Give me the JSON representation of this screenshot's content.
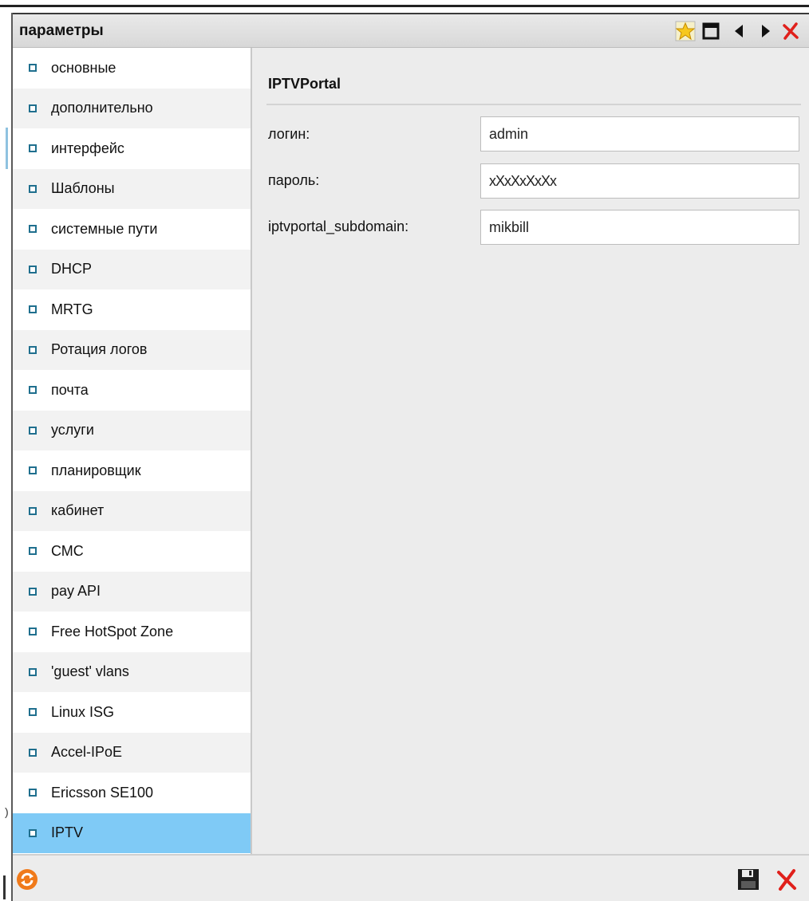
{
  "window": {
    "title": "параметры",
    "titlebar_icons": [
      "star-icon",
      "maximize-icon",
      "arrow-left-icon",
      "arrow-right-icon",
      "close-icon"
    ]
  },
  "sidebar": {
    "items": [
      {
        "label": "основные"
      },
      {
        "label": "дополнительно"
      },
      {
        "label": "интерфейс"
      },
      {
        "label": "Шаблоны"
      },
      {
        "label": "системные пути"
      },
      {
        "label": "DHCP"
      },
      {
        "label": "MRTG"
      },
      {
        "label": "Ротация логов"
      },
      {
        "label": "почта"
      },
      {
        "label": "услуги"
      },
      {
        "label": "планировщик"
      },
      {
        "label": "кабинет"
      },
      {
        "label": "СМС"
      },
      {
        "label": "pay API"
      },
      {
        "label": "Free HotSpot Zone"
      },
      {
        "label": "'guest' vlans"
      },
      {
        "label": "Linux ISG"
      },
      {
        "label": "Accel-IPoE"
      },
      {
        "label": "Ericsson SE100"
      },
      {
        "label": "IPTV",
        "active": true
      }
    ]
  },
  "main": {
    "section_title": "IPTVPortal",
    "fields": [
      {
        "label": "логин:",
        "value": "admin"
      },
      {
        "label": "пароль:",
        "value": "xXxXxXxXx"
      },
      {
        "label": "iptvportal_subdomain:",
        "value": "mikbill"
      }
    ]
  },
  "footer": {
    "icons": [
      "refresh-icon",
      "save-icon",
      "cancel-icon"
    ]
  },
  "colors": {
    "active_item": "#7fcaf6",
    "bullet": "#1f6f8e",
    "close_red": "#e0201b",
    "refresh_orange": "#f07a1a",
    "star_yellow": "#f7c81e"
  }
}
